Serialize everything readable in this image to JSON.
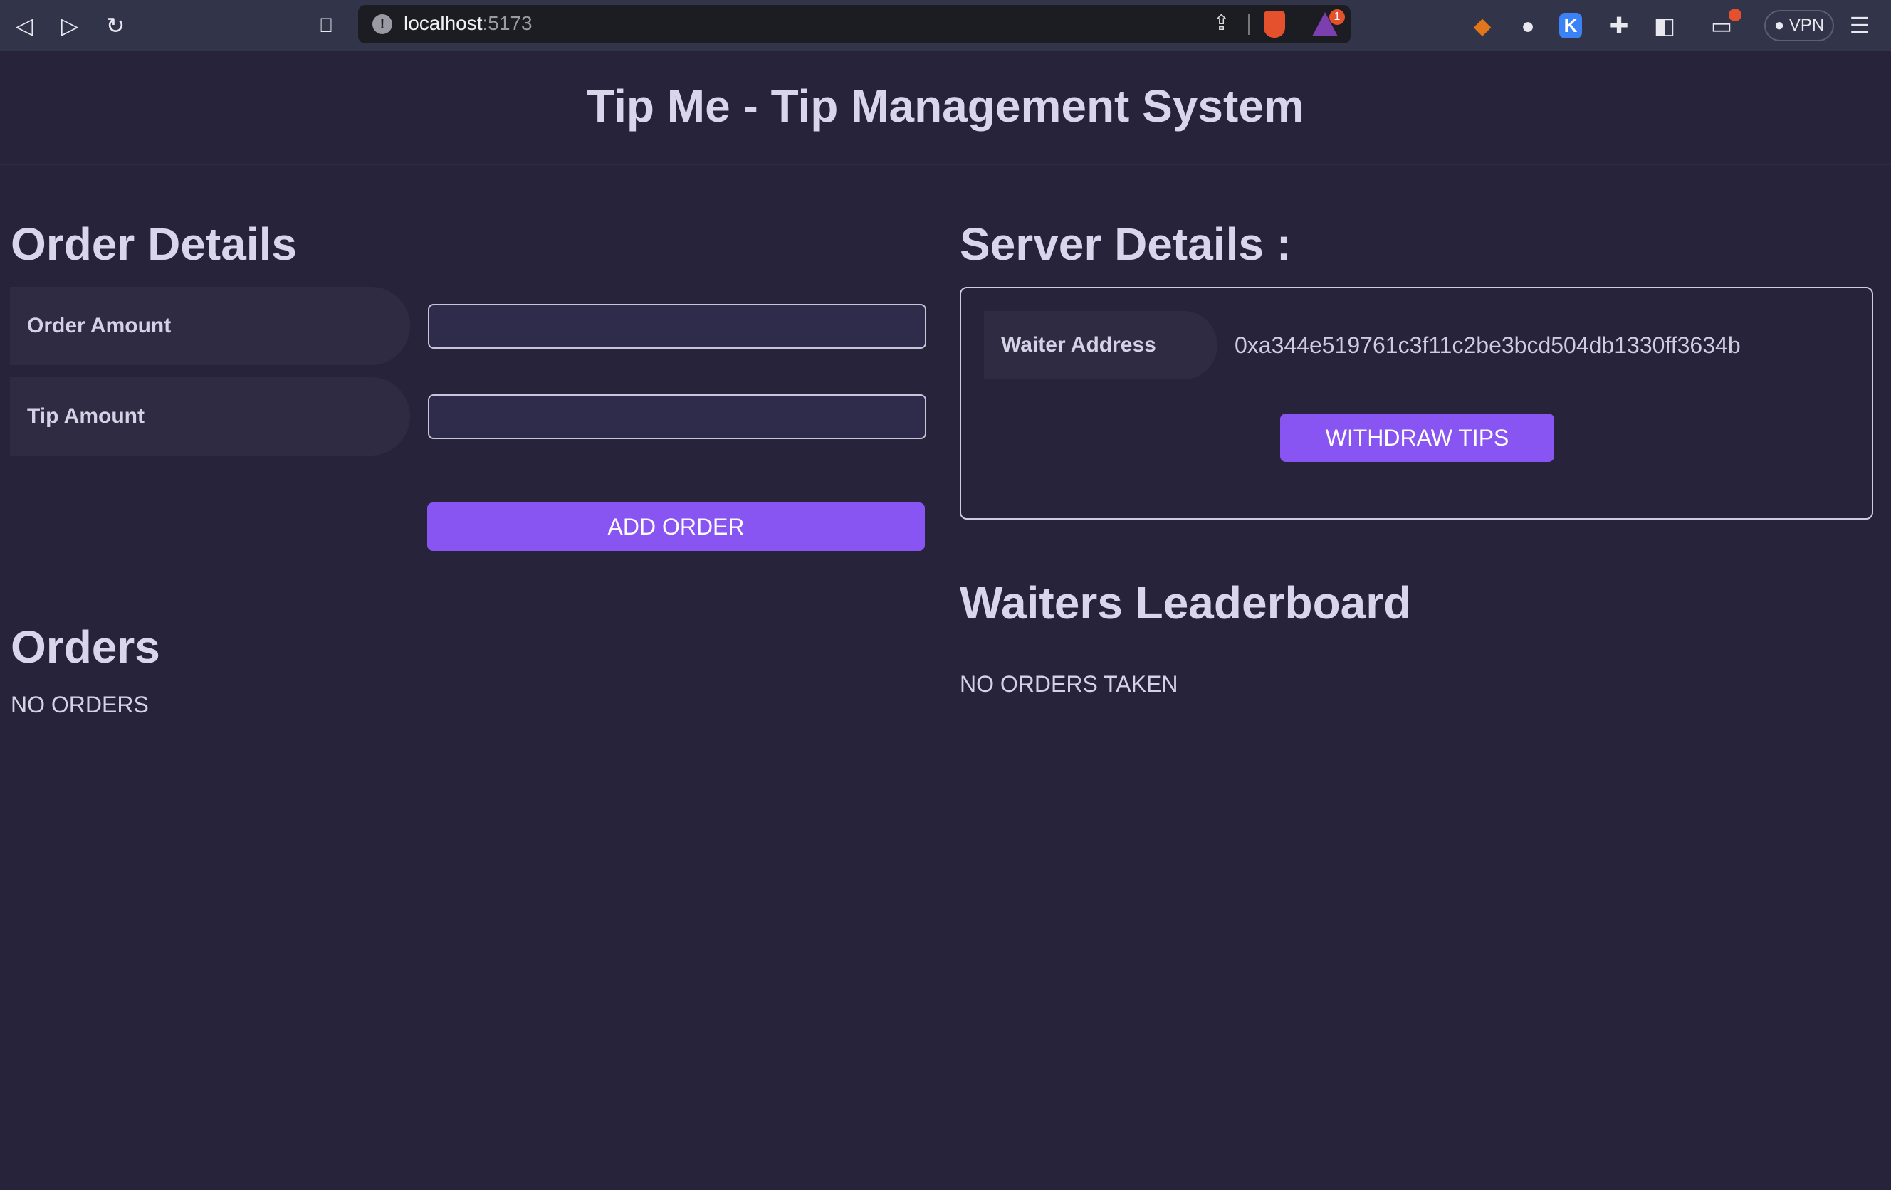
{
  "browser": {
    "url_host": "localhost",
    "url_port": ":5173",
    "notification_count": "1",
    "vpn_label": "VPN"
  },
  "header": {
    "title": "Tip Me - Tip Management System"
  },
  "order_details": {
    "heading": "Order Details",
    "order_amount_label": "Order Amount",
    "order_amount_value": "",
    "tip_amount_label": "Tip Amount",
    "tip_amount_value": "",
    "add_order_label": "ADD ORDER"
  },
  "orders": {
    "heading": "Orders",
    "empty_text": "NO ORDERS"
  },
  "server_details": {
    "heading": "Server Details :",
    "waiter_address_label": "Waiter Address",
    "waiter_address": "0xa344e519761c3f11c2be3bcd504db1330ff3634b",
    "withdraw_label": "WITHDRAW TIPS"
  },
  "leaderboard": {
    "heading": "Waiters Leaderboard",
    "empty_text": "NO ORDERS TAKEN"
  }
}
